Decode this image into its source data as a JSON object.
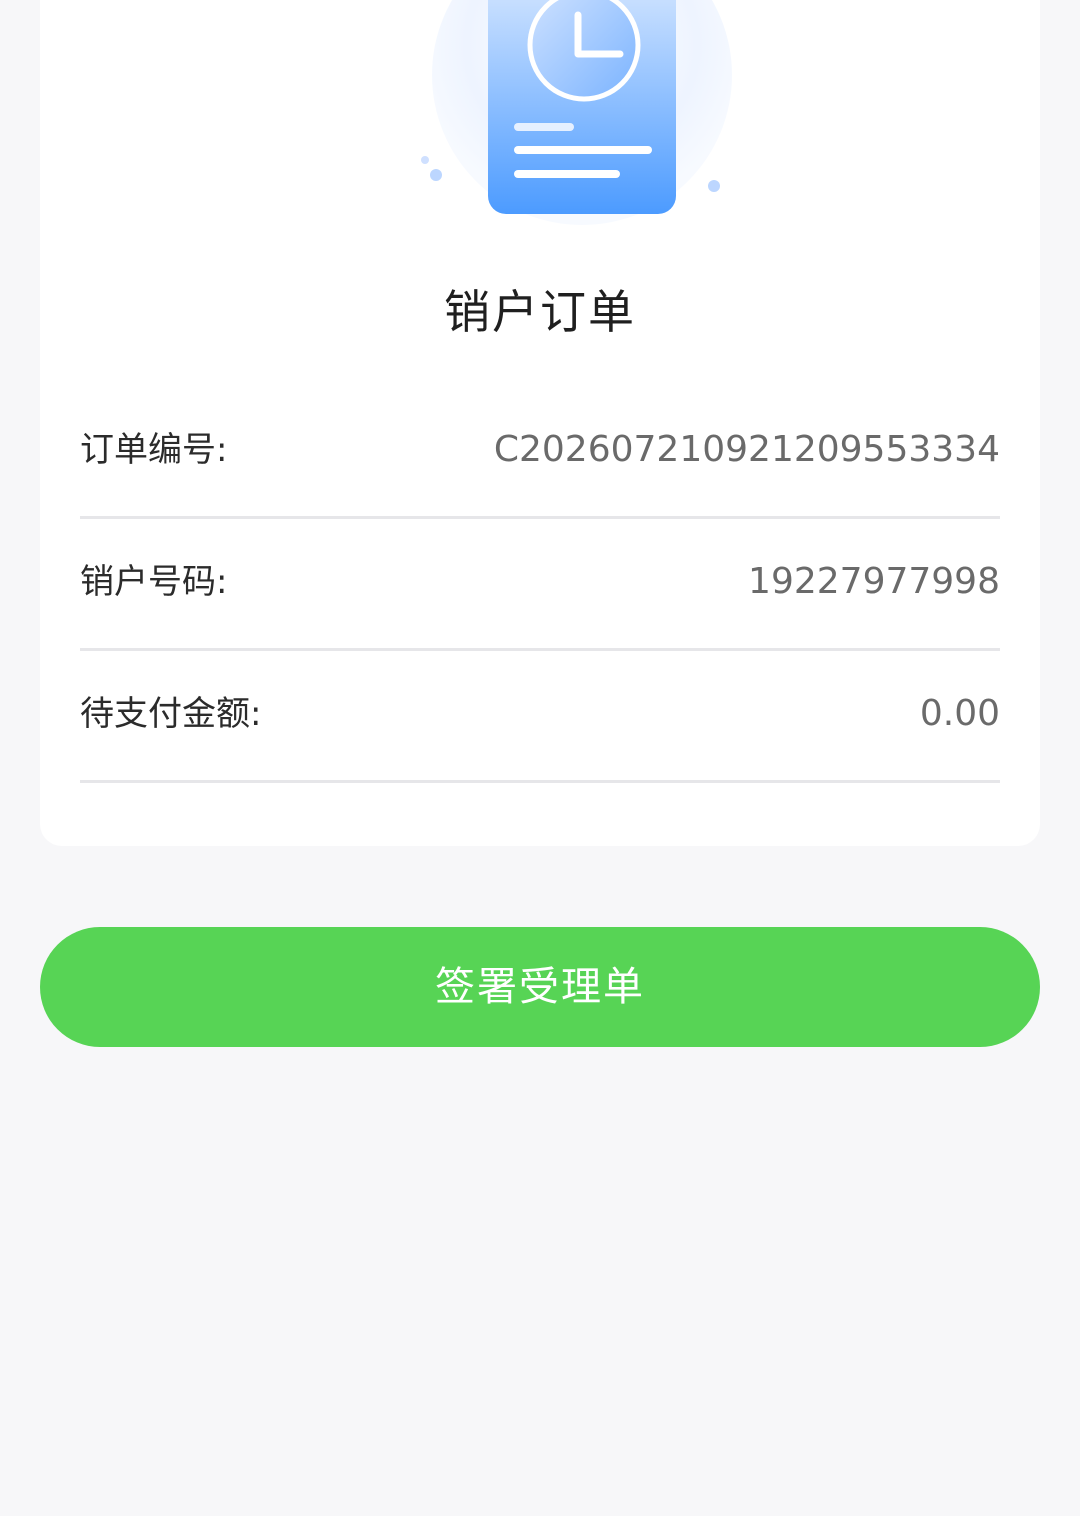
{
  "order": {
    "title": "销户订单",
    "icon": "order-clock-icon",
    "rows": [
      {
        "label": "订单编号:",
        "value": "C202607210921209553334"
      },
      {
        "label": "销户号码:",
        "value": "19227977998"
      },
      {
        "label": "待支付金额:",
        "value": "0.00"
      }
    ]
  },
  "actions": {
    "sign_label": "签署受理单"
  },
  "colors": {
    "primary_button": "#57d455",
    "accent_blue": "#4c9bff",
    "background": "#f7f7f9"
  }
}
